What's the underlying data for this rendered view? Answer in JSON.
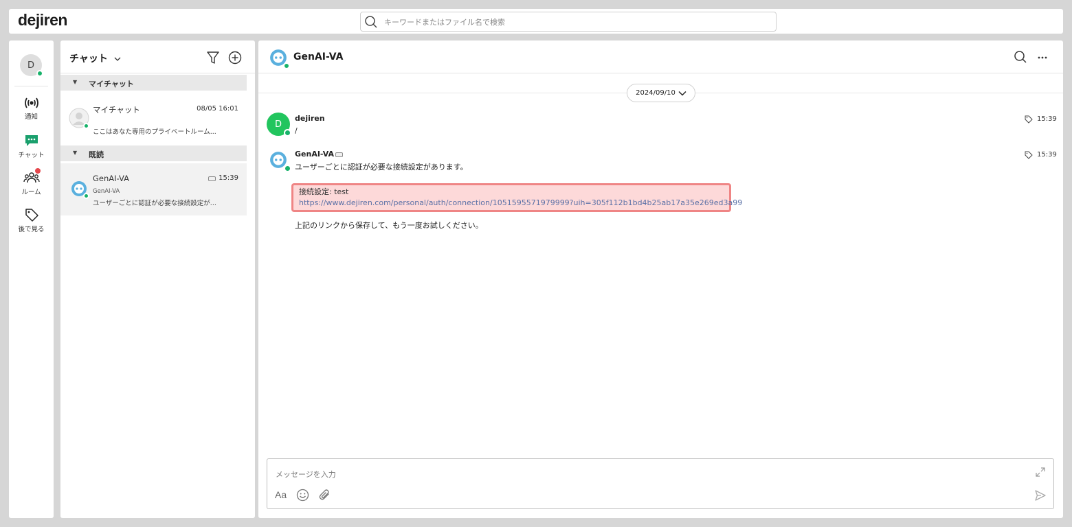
{
  "app": {
    "logo": "dejiren"
  },
  "search": {
    "placeholder": "キーワードまたはファイル名で検索"
  },
  "rail": {
    "user_initial": "D",
    "items": [
      {
        "label": "通知",
        "icon": "broadcast-icon"
      },
      {
        "label": "チャット",
        "icon": "chat-icon"
      },
      {
        "label": "ルーム",
        "icon": "people-icon"
      },
      {
        "label": "後で見る",
        "icon": "tag-icon"
      }
    ]
  },
  "list": {
    "title": "チャット",
    "sections": [
      {
        "label": "マイチャット"
      },
      {
        "label": "既読"
      }
    ],
    "my_chat": {
      "name": "マイチャット",
      "time": "08/05 16:01",
      "preview": "ここはあなた専用のプライベートルーム..."
    },
    "genai_chat": {
      "name": "GenAI-VA",
      "time": "15:39",
      "sub": "GenAI-VA",
      "preview": "ユーザーごとに認証が必要な接続設定が..."
    }
  },
  "main": {
    "title": "GenAI-VA",
    "date": "2024/09/10",
    "messages": [
      {
        "avatar_initial": "D",
        "sender": "dejiren",
        "text": "/",
        "time": "15:39"
      },
      {
        "sender": "GenAI-VA",
        "text": "ユーザーごとに認証が必要な接続設定があります。",
        "time": "15:39",
        "conn_label": "接続設定: test",
        "conn_link": "https://www.dejiren.com/personal/auth/connection/1051595571979999?uih=305f112b1bd4b25ab17a35e269ed3a99",
        "footer": "上記のリンクから保存して、もう一度お試しください。"
      }
    ]
  },
  "composer": {
    "placeholder": "メッセージを入力",
    "format_label": "Aa"
  },
  "colors": {
    "online": "#17b26a",
    "highlight_bg": "#fdd9d9",
    "highlight_border": "#ef8585",
    "accent_green": "#1aa06d"
  }
}
